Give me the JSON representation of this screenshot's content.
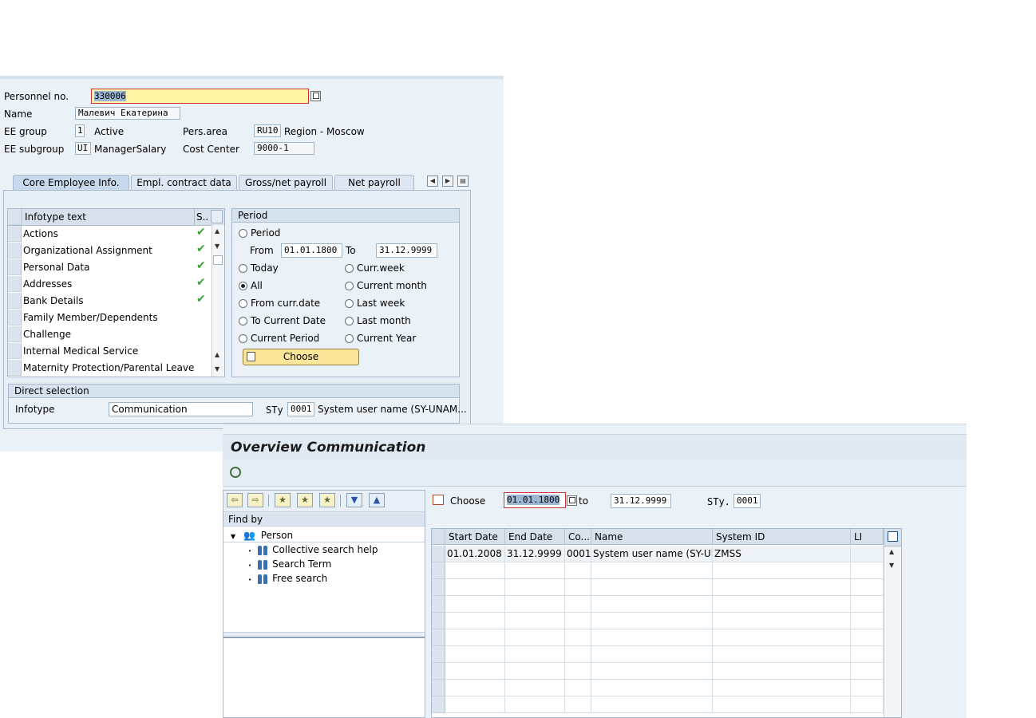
{
  "window1": {
    "header": {
      "personnel_no_label": "Personnel no.",
      "personnel_no_value": "330006",
      "name_label": "Name",
      "name_value": "Малевич Екатерина",
      "ee_group_label": "EE group",
      "ee_group_code": "1",
      "ee_group_text": "Active",
      "pers_area_label": "Pers.area",
      "pers_area_code": "RU10",
      "pers_area_text": "Region - Moscow",
      "ee_subgroup_label": "EE subgroup",
      "ee_subgroup_code": "UI",
      "ee_subgroup_text": "ManagerSalary",
      "cost_center_label": "Cost Center",
      "cost_center_value": "9000-1"
    },
    "tabs": [
      "Core Employee Info.",
      "Empl. contract data",
      "Gross/net payroll",
      "Net payroll"
    ],
    "infotype_table": {
      "col_text": "Infotype text",
      "col_status": "S..",
      "rows": [
        {
          "text": "Actions",
          "status": "✔"
        },
        {
          "text": "Organizational Assignment",
          "status": "✔"
        },
        {
          "text": "Personal Data",
          "status": "✔"
        },
        {
          "text": "Addresses",
          "status": "✔"
        },
        {
          "text": "Bank Details",
          "status": "✔"
        },
        {
          "text": "Family Member/Dependents",
          "status": ""
        },
        {
          "text": "Challenge",
          "status": ""
        },
        {
          "text": "Internal Medical Service",
          "status": ""
        },
        {
          "text": "Maternity Protection/Parental Leave",
          "status": ""
        }
      ]
    },
    "period": {
      "title": "Period",
      "period_label": "Period",
      "from_label": "From",
      "from_value": "01.01.1800",
      "to_label": "To",
      "to_value": "31.12.9999",
      "options_left": [
        "Today",
        "All",
        "From curr.date",
        "To Current Date",
        "Current Period"
      ],
      "options_right": [
        "Curr.week",
        "Current month",
        "Last week",
        "Last month",
        "Current Year"
      ],
      "selected": "All",
      "choose_label": "Choose"
    },
    "direct_selection": {
      "title": "Direct selection",
      "infotype_label": "Infotype",
      "infotype_value": "Communication",
      "sty_label": "STy",
      "sty_value": "0001",
      "sty_text": "System user name (SY-UNAM..."
    }
  },
  "window2": {
    "title": "Overview Communication",
    "find_by": "Find by",
    "tree": {
      "root": "Person",
      "children": [
        "Collective search help",
        "Search Term",
        "Free search"
      ]
    },
    "filter": {
      "choose_label": "Choose",
      "from_value": "01.01.1800",
      "to_label": "to",
      "to_value": "31.12.9999",
      "sty_label": "STy.",
      "sty_value": "0001"
    },
    "grid": {
      "columns": [
        "Start Date",
        "End Date",
        "Co...",
        "Name",
        "System ID",
        "LI"
      ],
      "rows": [
        [
          "01.01.2008",
          "31.12.9999",
          "0001",
          "System user name (SY-UN...",
          "ZMSS",
          ""
        ]
      ]
    }
  },
  "colors": {
    "background": "#eaf1f7",
    "header_blue": "#d6e1ec",
    "required_yellow": "#fff3a6",
    "button_yellow": "#fbe69a",
    "check_green": "#3aa33a"
  }
}
